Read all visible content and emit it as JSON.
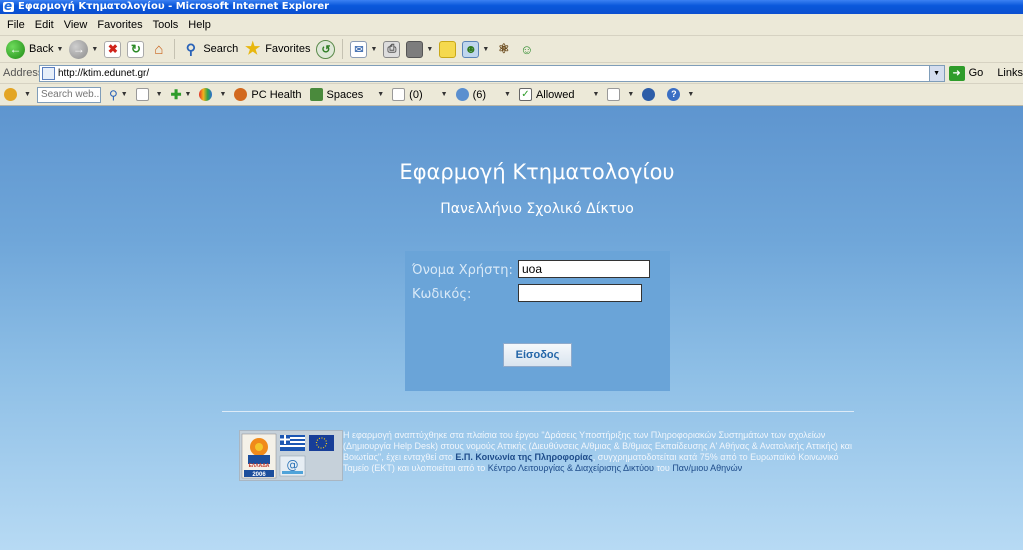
{
  "window": {
    "title": "Εφαρμογή Κτηματολογίου - Microsoft Internet Explorer"
  },
  "menu": [
    "File",
    "Edit",
    "View",
    "Favorites",
    "Tools",
    "Help"
  ],
  "toolbar": {
    "back_label": "Back",
    "search_label": "Search",
    "favorites_label": "Favorites"
  },
  "address": {
    "label": "Address",
    "url": "http://ktim.edunet.gr/",
    "go_label": "Go",
    "links_label": "Links"
  },
  "linksbar": {
    "search_placeholder": "Search web...",
    "pc_health": "PC Health",
    "spaces": "Spaces",
    "mail_count": "(0)",
    "people_count": "(6)",
    "allowed": "Allowed"
  },
  "page": {
    "title": "Εφαρμογή Κτηματολογίου",
    "subtitle": "Πανελλήνιο Σχολικό Δίκτυο",
    "username_label": "Όνομα Χρήστη:",
    "username_value": "uoa",
    "password_label": "Κωδικός:",
    "login_button": "Είσοδος",
    "logos": [
      "ΕΛΛΑΔΑ 2006"
    ],
    "footer": {
      "part1": "Η εφαρμογή αναπτύχθηκε στα πλαίσια του έργου \"Δράσεις Υποστήριξης των Πληροφοριακών Συστημάτων των σχολείων (Δημιουργία Help Desk) στους νομούς Αττικής (Διευθύνσεις Α/θμιας & Β/θμιας Εκπαίδευσης Α' Αθήνας & Ανατολικής Αττικής) και Βοιωτίας\", έχει ενταχθεί στο",
      "program": "Ε.Π. Κοινωνία της Πληροφορίας",
      "part2": ", συγχρηματοδοτείται κατά 75% από το Ευρωπαϊκό Κοινωνικό Ταμείο (ΕΚΤ) και υλοποιείται από το",
      "center": "Κέντρο Λειτουργίας & Διαχείρισης Δικτύου",
      "part3": "του",
      "univ": "Παν/μιου Αθηνών"
    }
  }
}
